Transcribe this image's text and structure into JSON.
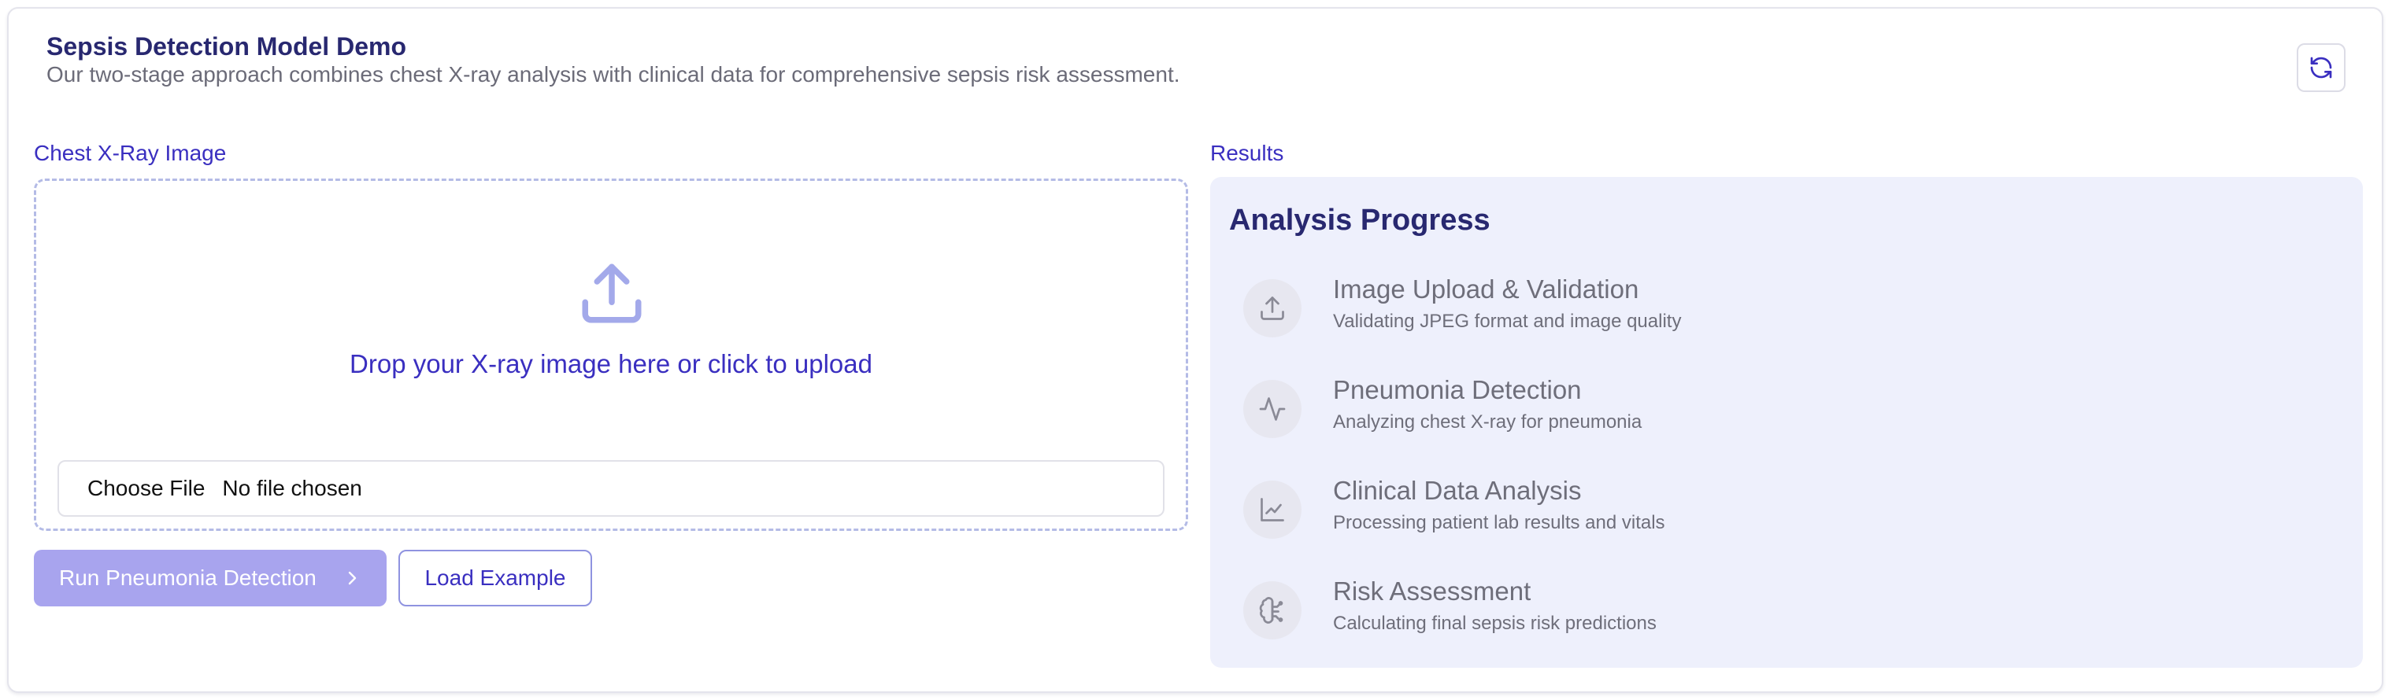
{
  "header": {
    "title": "Sepsis Detection Model Demo",
    "subtitle": "Our two-stage approach combines chest X-ray analysis with clinical data for comprehensive sepsis risk assessment.",
    "refresh_icon": "refresh-icon"
  },
  "upload": {
    "section_label": "Chest X-Ray Image",
    "icon": "upload-icon",
    "drop_text": "Drop your X-ray image here or click to upload",
    "choose_file_label": "Choose File",
    "file_status": "No file chosen"
  },
  "actions": {
    "run_label": "Run Pneumonia Detection",
    "run_icon": "chevron-right-icon",
    "load_example_label": "Load Example"
  },
  "results": {
    "section_label": "Results",
    "progress_title": "Analysis Progress",
    "steps": [
      {
        "icon": "upload-icon",
        "title": "Image Upload & Validation",
        "description": "Validating JPEG format and image quality"
      },
      {
        "icon": "activity-icon",
        "title": "Pneumonia Detection",
        "description": "Analyzing chest X-ray for pneumonia"
      },
      {
        "icon": "line-chart-icon",
        "title": "Clinical Data Analysis",
        "description": "Processing patient lab results and vitals"
      },
      {
        "icon": "brain-icon",
        "title": "Risk Assessment",
        "description": "Calculating final sepsis risk predictions"
      }
    ]
  },
  "colors": {
    "accent": "#3a2fc0",
    "heading": "#282870",
    "disabled_button": "#a8a4ee",
    "results_background": "#eef0fc",
    "muted_text": "#6e6e7a"
  }
}
